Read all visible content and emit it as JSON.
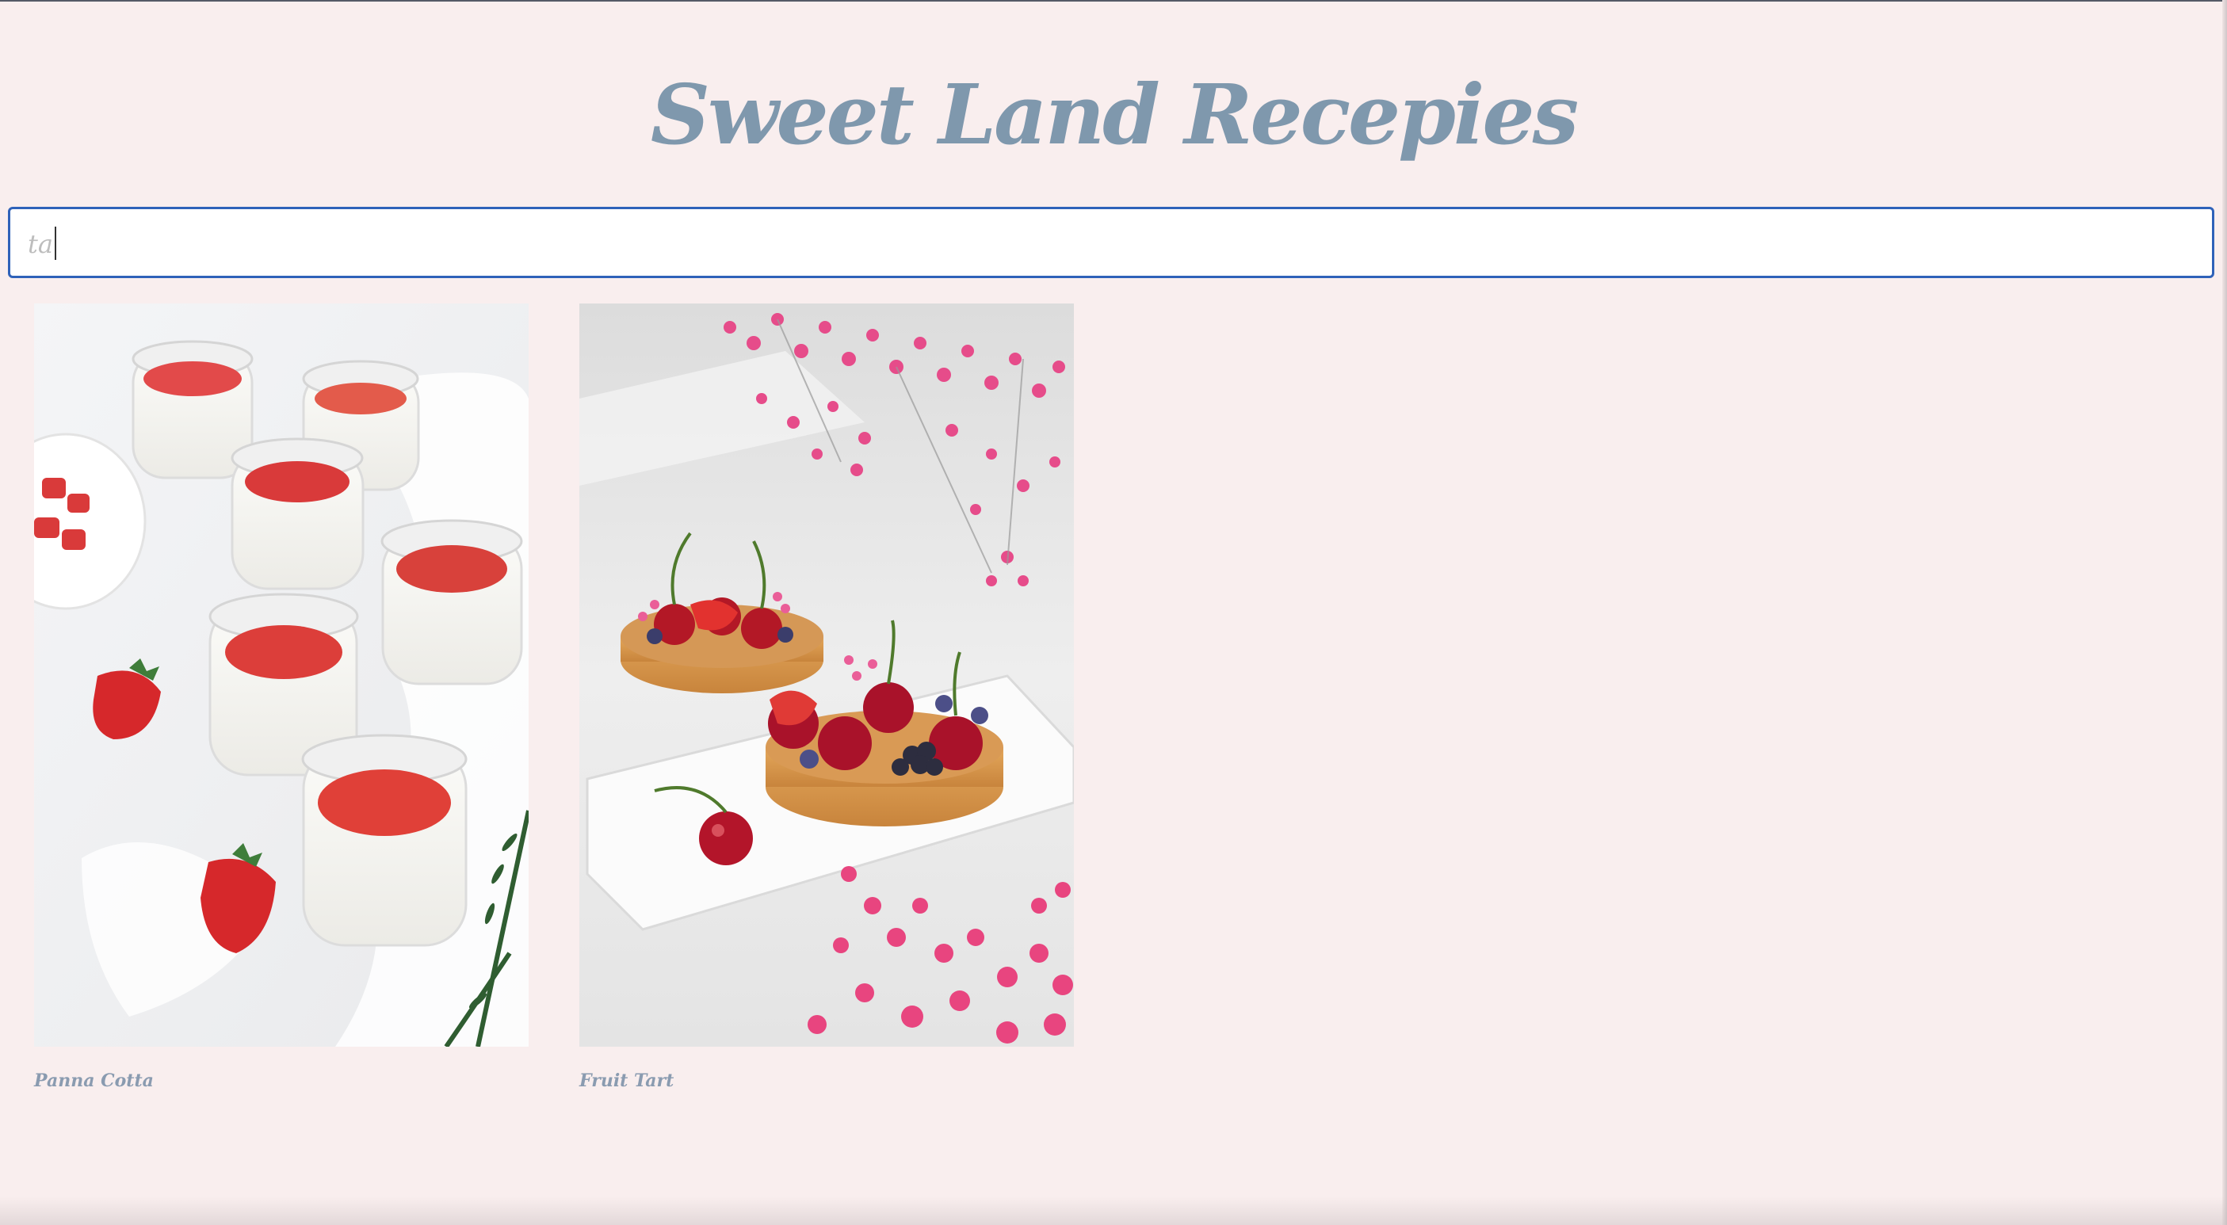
{
  "site": {
    "title": "Sweet Land Recepies"
  },
  "search": {
    "value": "ta",
    "placeholder": ""
  },
  "recipes": [
    {
      "title": "Panna Cotta",
      "image": "panna-cotta-photo"
    },
    {
      "title": "Fruit Tart",
      "image": "fruit-tart-photo"
    }
  ],
  "colors": {
    "background": "#f9eeee",
    "title": "#7f98ad",
    "search_border": "#2f62b9",
    "card_title": "#8a9bb0"
  }
}
